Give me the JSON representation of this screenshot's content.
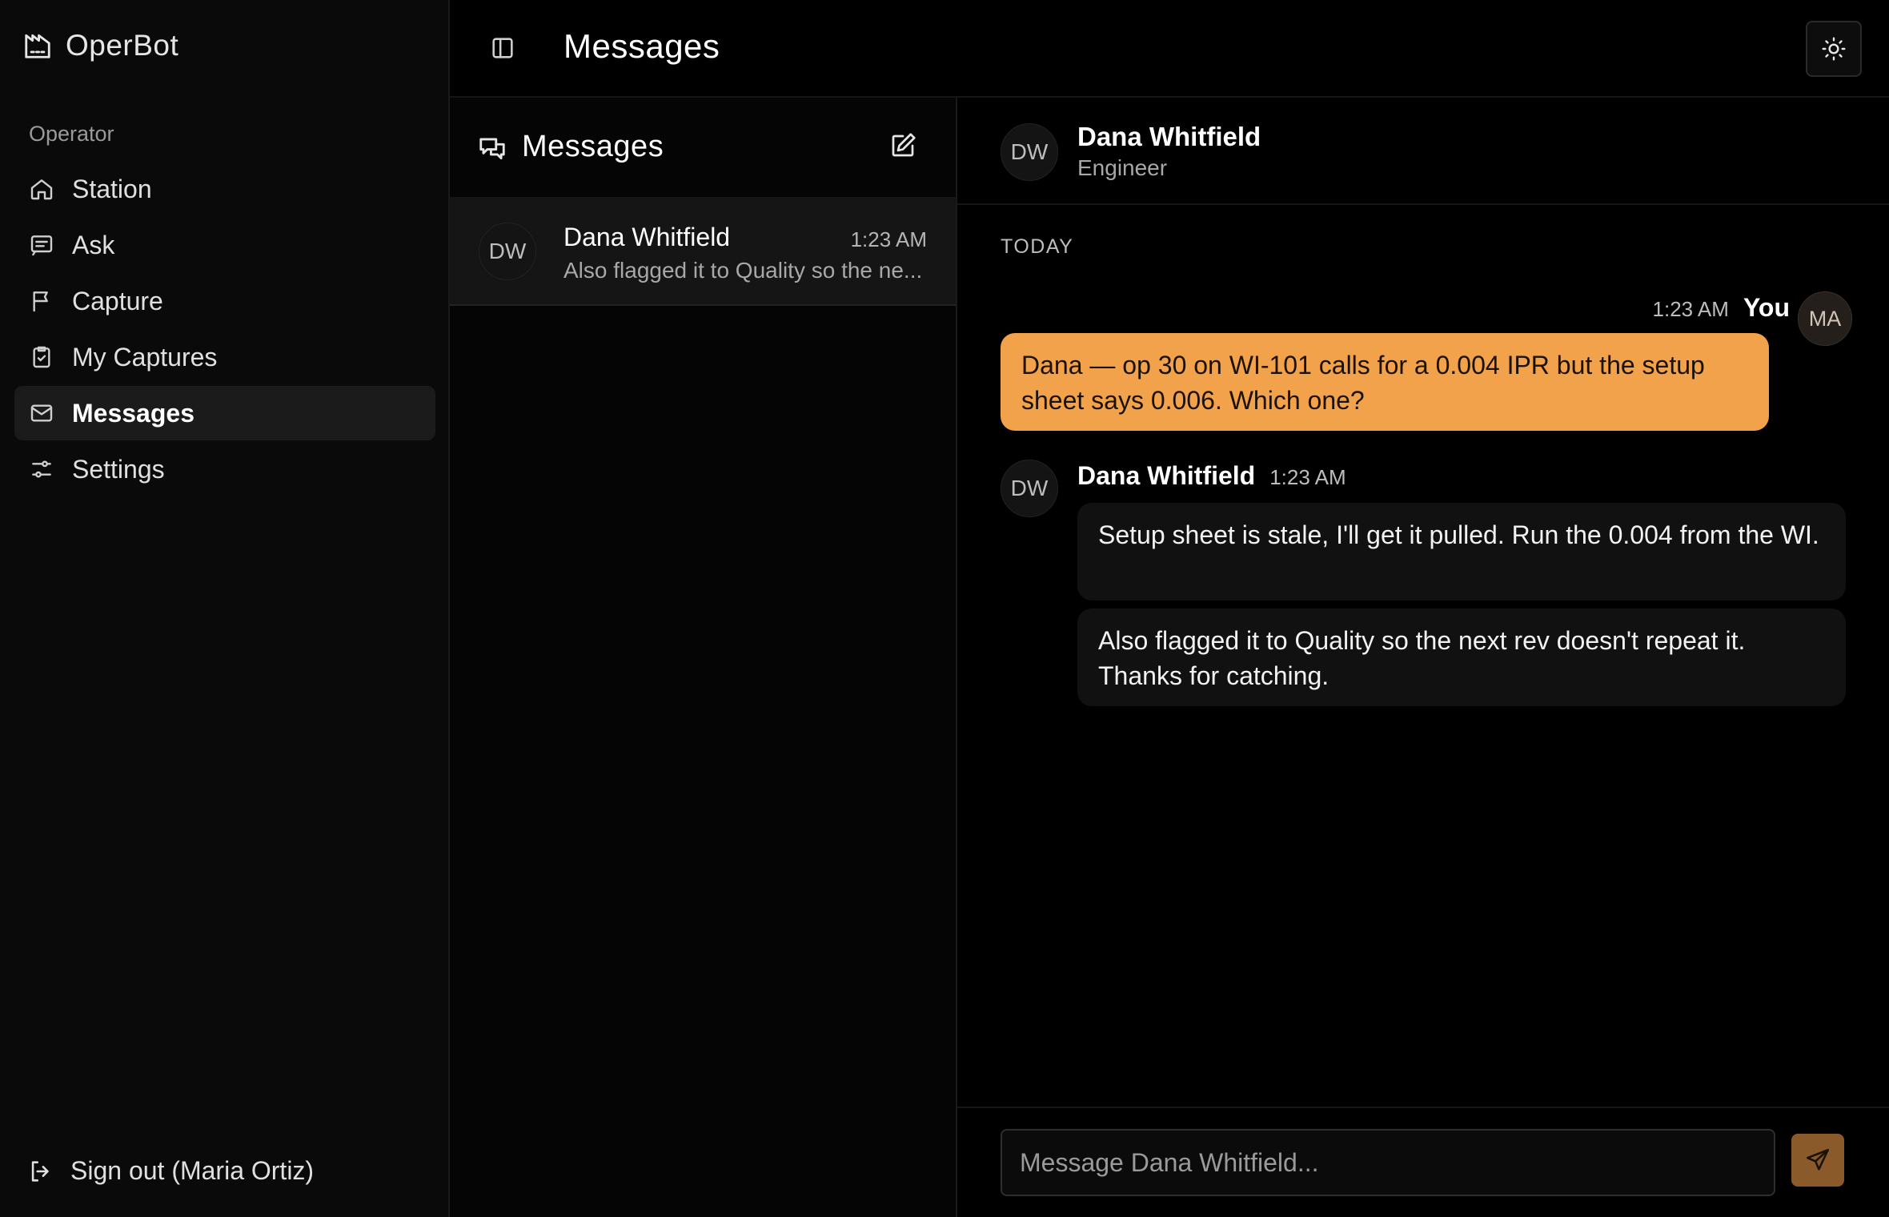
{
  "app": {
    "name": "OperBot"
  },
  "sidebar": {
    "section_label": "Operator",
    "items": [
      {
        "label": "Station",
        "icon": "home-icon"
      },
      {
        "label": "Ask",
        "icon": "chat-icon"
      },
      {
        "label": "Capture",
        "icon": "flag-icon"
      },
      {
        "label": "My Captures",
        "icon": "clipboard-check-icon"
      },
      {
        "label": "Messages",
        "icon": "mail-icon",
        "active": true
      },
      {
        "label": "Settings",
        "icon": "sliders-icon"
      }
    ],
    "signout_label": "Sign out (Maria Ortiz)"
  },
  "header": {
    "title": "Messages"
  },
  "conversation_list": {
    "title": "Messages",
    "items": [
      {
        "initials": "DW",
        "name": "Dana Whitfield",
        "time": "1:23 AM",
        "preview": "Also flagged it to Quality so the ne..."
      }
    ]
  },
  "chat": {
    "contact": {
      "initials": "DW",
      "name": "Dana Whitfield",
      "role": "Engineer"
    },
    "day_label": "TODAY",
    "messages": [
      {
        "from": "You",
        "initials": "MA",
        "time": "1:23 AM",
        "text": "Dana — op 30 on WI-101 calls for a 0.004 IPR but the setup sheet says 0.006. Which one?"
      },
      {
        "from": "Dana Whitfield",
        "initials": "DW",
        "time": "1:23 AM",
        "texts": [
          "Setup sheet is stale, I'll get it pulled. Run the 0.004 from the WI.",
          "Also flagged it to Quality so the next rev doesn't repeat it. Thanks for catching."
        ]
      }
    ],
    "input_placeholder": "Message Dana Whitfield..."
  },
  "colors": {
    "accent": "#f2a24a",
    "send_button": "#8a5a2a",
    "background": "#000000",
    "sidebar_bg": "#0a0a0a"
  }
}
